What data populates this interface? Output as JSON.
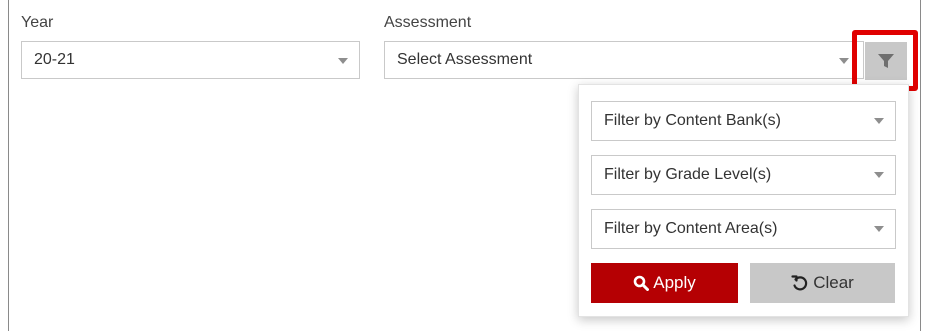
{
  "year": {
    "label": "Year",
    "selected": "20-21"
  },
  "assessment": {
    "label": "Assessment",
    "placeholder": "Select Assessment"
  },
  "filter_toggle": {
    "icon": "filter-icon",
    "highlight_color": "#e00000"
  },
  "filter_panel": {
    "content_bank": "Filter by Content Bank(s)",
    "grade_level": "Filter by Grade Level(s)",
    "content_area": "Filter by Content Area(s)",
    "apply_label": "Apply",
    "apply_icon": "search-icon",
    "clear_label": "Clear",
    "clear_icon": "undo-icon"
  },
  "colors": {
    "apply_bg": "#b50003",
    "clear_bg": "#c8c8c8"
  }
}
